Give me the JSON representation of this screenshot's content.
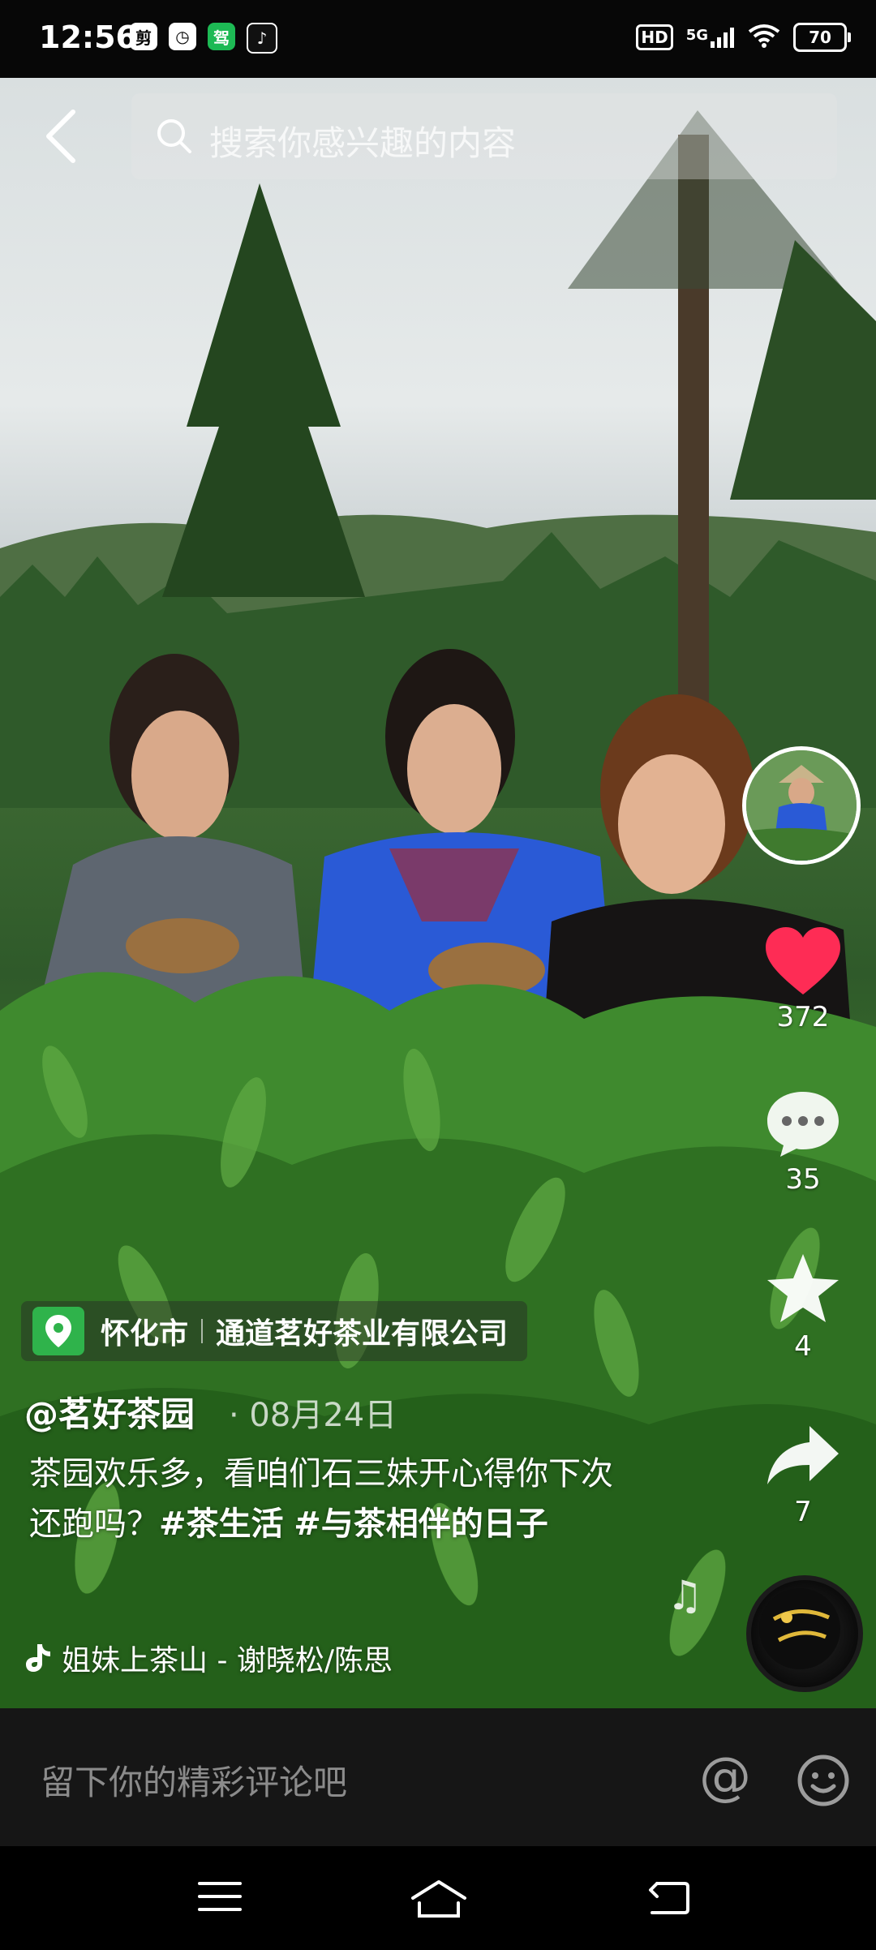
{
  "status_bar": {
    "time": "12:56",
    "app_icons": [
      "剪",
      "◷",
      "驾",
      "♪"
    ],
    "hd": "HD",
    "network": "5G",
    "battery": "70"
  },
  "search": {
    "placeholder": "搜索你感兴趣的内容"
  },
  "rail": {
    "likes": "372",
    "comments": "35",
    "favorites": "4",
    "shares": "7"
  },
  "location": {
    "city": "怀化市",
    "company": "通道茗好茶业有限公司"
  },
  "post": {
    "author": "@茗好茶园",
    "date": "· 08月24日",
    "caption_text": "茶园欢乐多，看咱们石三妹开心得你下次还跑吗？",
    "hashtag1": "#茶生活",
    "hashtag2": "#与茶相伴的日子",
    "music": "姐妹上茶山 - 谢晓松/陈思"
  },
  "comment_bar": {
    "placeholder": "留下你的精彩评论吧",
    "at_label": "@"
  },
  "colors": {
    "like": "#fe2c55",
    "location_pin": "#2fb34b"
  }
}
